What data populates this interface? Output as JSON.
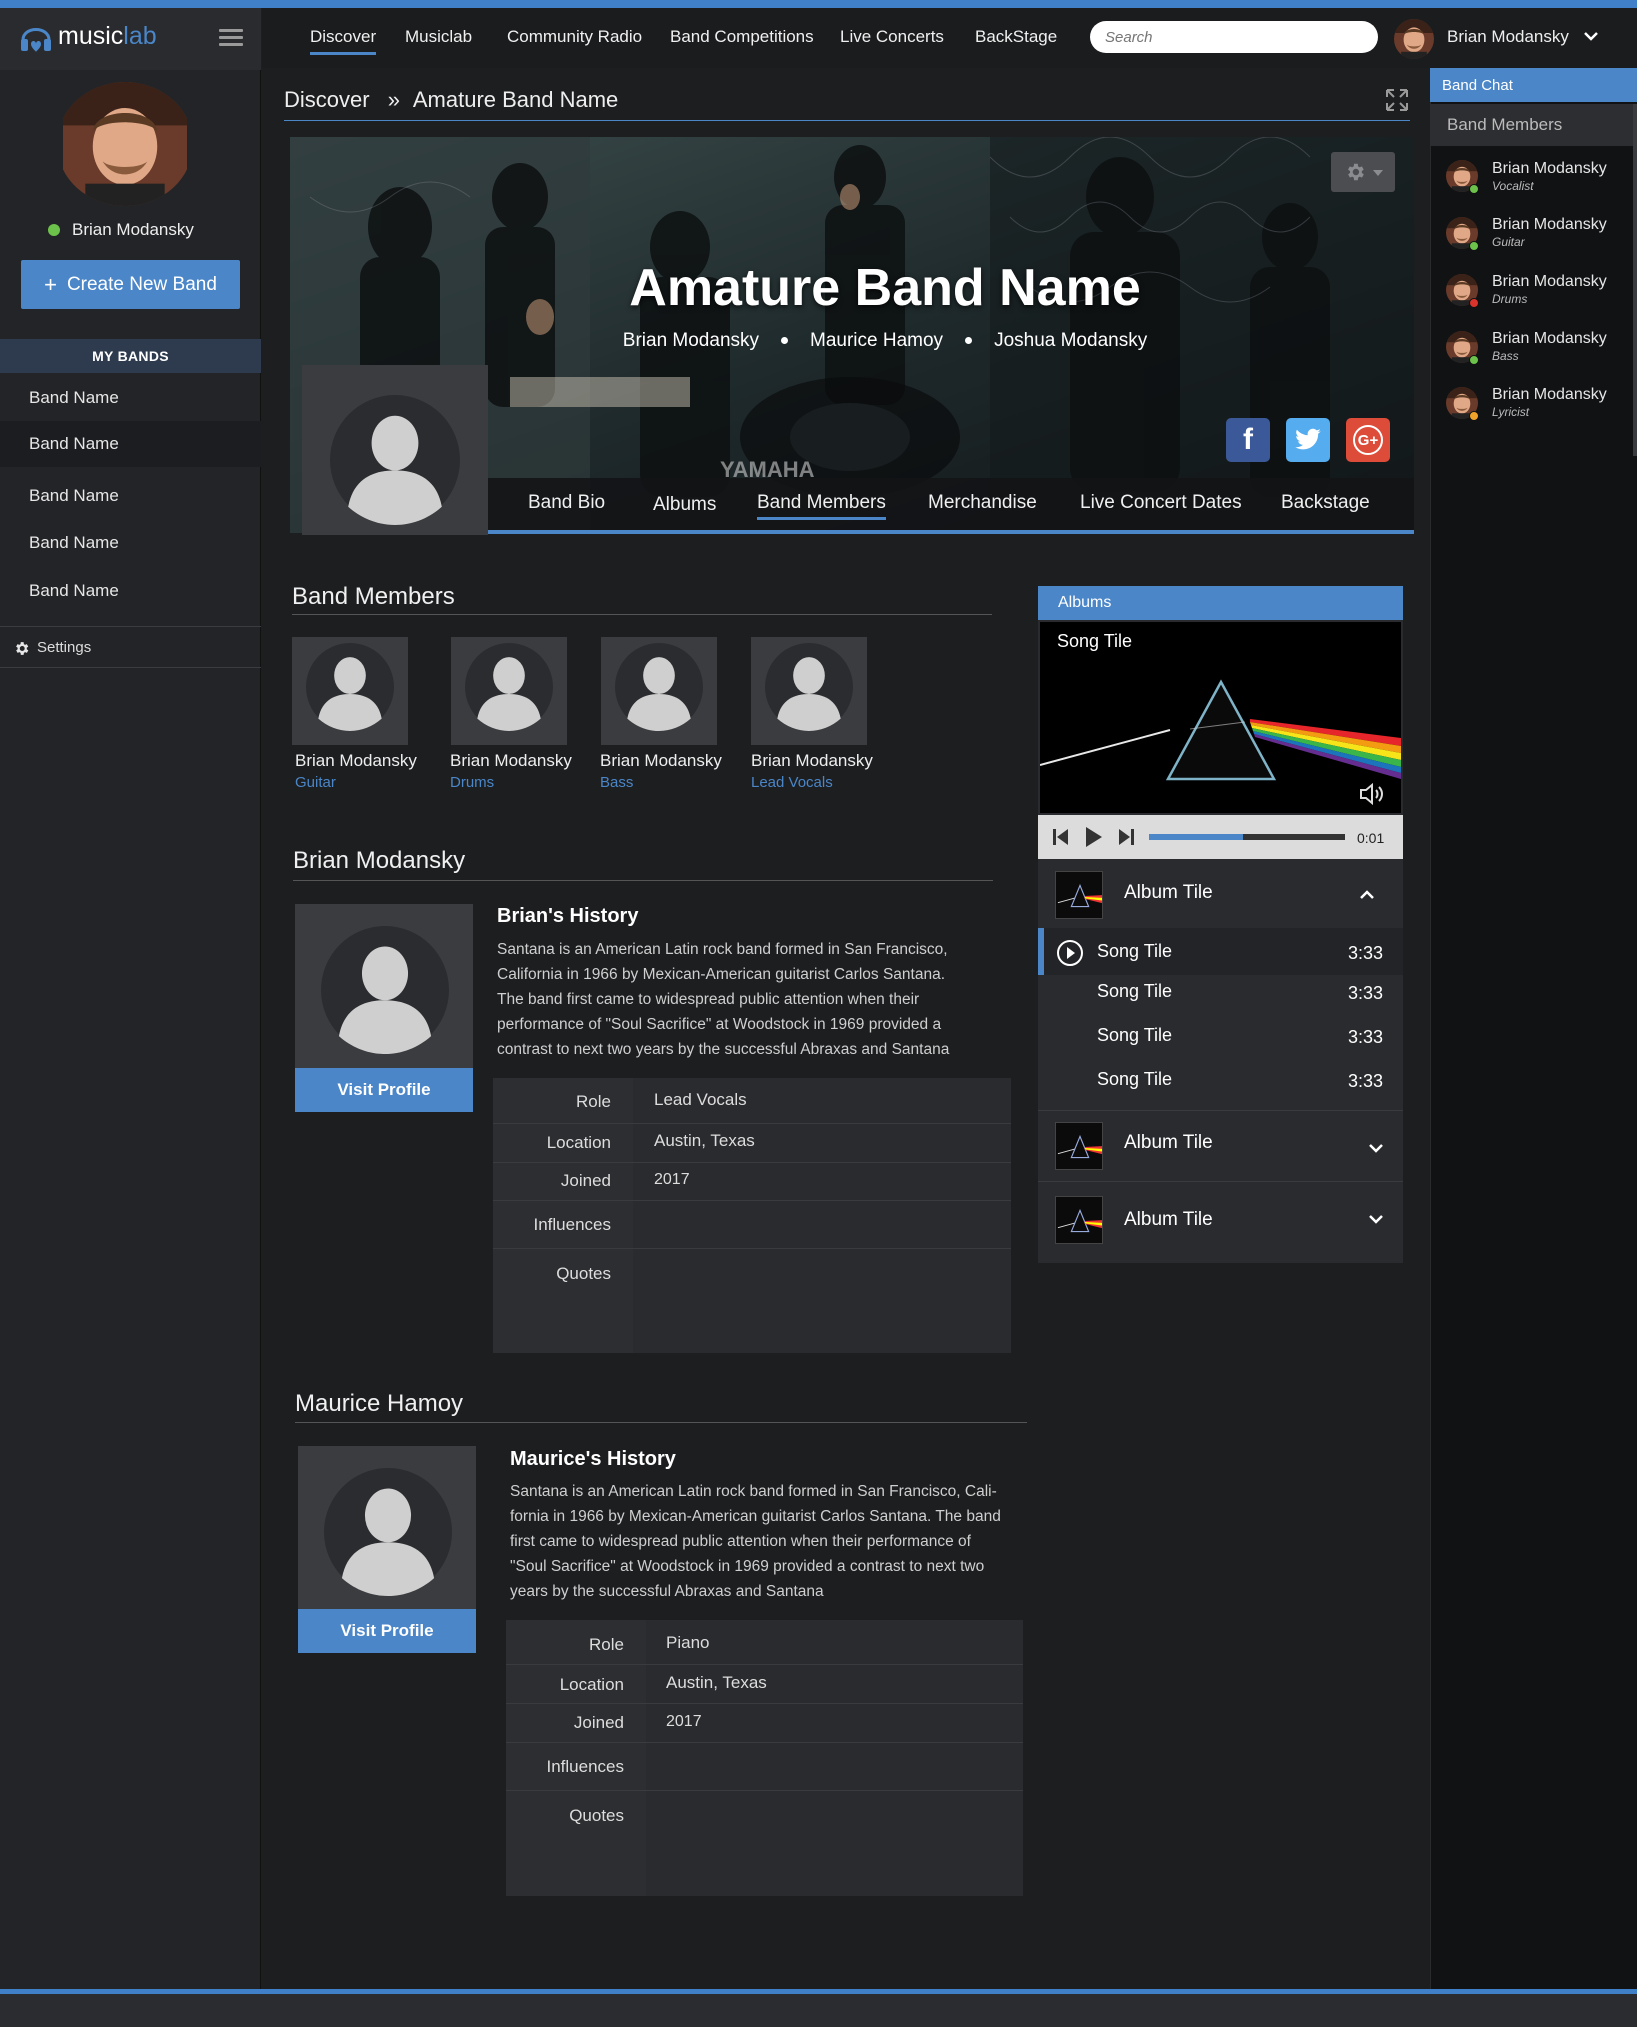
{
  "app": {
    "logo_prefix": "music",
    "logo_suffix": "lab"
  },
  "topnav": {
    "links": [
      "Discover",
      "Musiclab",
      "Community Radio",
      "Band Competitions",
      "Live Concerts",
      "BackStage"
    ],
    "active": "Discover",
    "search_placeholder": "Search",
    "username": "Brian Modansky"
  },
  "sidebar": {
    "username": "Brian Modansky",
    "status": "online",
    "create_button": "Create New Band",
    "create_plus": "+",
    "mybands_header": "MY BANDS",
    "bands": [
      "Band Name",
      "Band Name",
      "Band Name",
      "Band Name",
      "Band Name"
    ],
    "settings_label": "Settings"
  },
  "breadcrumb": {
    "root": "Discover",
    "separator": "»",
    "current": "Amature Band Name"
  },
  "hero": {
    "title": "Amature Band Name",
    "members": [
      "Brian Modansky",
      "Maurice Hamoy",
      "Joshua Modansky"
    ],
    "stage_text": "YAMAHA",
    "social": {
      "facebook": "f",
      "googleplus": "G+"
    },
    "tabs": [
      "Band Bio",
      "Albums",
      "Band Members",
      "Merchandise",
      "Live Concert Dates",
      "Backstage"
    ],
    "active_tab": "Band Members"
  },
  "band_members": {
    "title": "Band Members",
    "members": [
      {
        "name": "Brian Modansky",
        "role": "Guitar"
      },
      {
        "name": "Brian Modansky",
        "role": "Drums"
      },
      {
        "name": "Brian Modansky",
        "role": "Bass"
      },
      {
        "name": "Brian Modansky",
        "role": "Lead Vocals"
      }
    ]
  },
  "profiles": [
    {
      "name": "Brian Modansky",
      "visit_label": "Visit Profile",
      "history_title": "Brian's History",
      "history_lines": [
        "Santana is an American Latin rock band formed in San Francisco,",
        "California in 1966 by Mexican-American guitarist Carlos Santana.",
        "The band first came to widespread public attention when their",
        "performance of \"Soul Sacrifice\" at Woodstock in 1969 provided a",
        "contrast to next two years by the successful Abraxas and Santana"
      ],
      "labels": {
        "role": "Role",
        "location": "Location",
        "joined": "Joined",
        "influences": "Influences",
        "quotes": "Quotes"
      },
      "role": "Lead Vocals",
      "location": "Austin, Texas",
      "joined": "2017",
      "influences": "",
      "quotes": ""
    },
    {
      "name": "Maurice Hamoy",
      "visit_label": "Visit Profile",
      "history_title": "Maurice's History",
      "history_lines": [
        "Santana is an American Latin rock band formed in San Francisco, Cali-",
        "fornia in 1966 by Mexican-American guitarist Carlos Santana. The band",
        "first came to widespread public attention when their performance of",
        "\"Soul Sacrifice\" at Woodstock in 1969 provided a contrast to next two",
        "years by the successful Abraxas and Santana"
      ],
      "labels": {
        "role": "Role",
        "location": "Location",
        "joined": "Joined",
        "influences": "Influences",
        "quotes": "Quotes"
      },
      "role": "Piano",
      "location": "Austin, Texas",
      "joined": "2017",
      "influences": "",
      "quotes": ""
    }
  ],
  "albums_panel": {
    "header": "Albums",
    "now_playing": "Song Tile",
    "time": "0:01",
    "progress": 0.48,
    "albums": [
      {
        "title": "Album Tile",
        "expanded": true,
        "songs": [
          {
            "title": "Song Tile",
            "duration": "3:33",
            "playing": true
          },
          {
            "title": "Song Tile",
            "duration": "3:33"
          },
          {
            "title": "Song Tile",
            "duration": "3:33"
          },
          {
            "title": "Song Tile",
            "duration": "3:33"
          }
        ]
      },
      {
        "title": "Album Tile",
        "expanded": false
      },
      {
        "title": "Album Tile",
        "expanded": false
      }
    ]
  },
  "chat": {
    "header": "Band Chat",
    "subheader": "Band Members",
    "members": [
      {
        "name": "Brian Modansky",
        "role": "Vocalist",
        "status_color": "#6cc24a"
      },
      {
        "name": "Brian Modansky",
        "role": "Guitar",
        "status_color": "#6cc24a"
      },
      {
        "name": "Brian Modansky",
        "role": "Drums",
        "status_color": "#d9342b"
      },
      {
        "name": "Brian Modansky",
        "role": "Bass",
        "status_color": "#6cc24a"
      },
      {
        "name": "Brian Modansky",
        "role": "Lyricist",
        "status_color": "#f0a32a"
      }
    ]
  },
  "colors": {
    "accent": "#4a86c8",
    "online": "#6cc24a",
    "busy": "#d9342b",
    "away": "#f0a32a"
  }
}
